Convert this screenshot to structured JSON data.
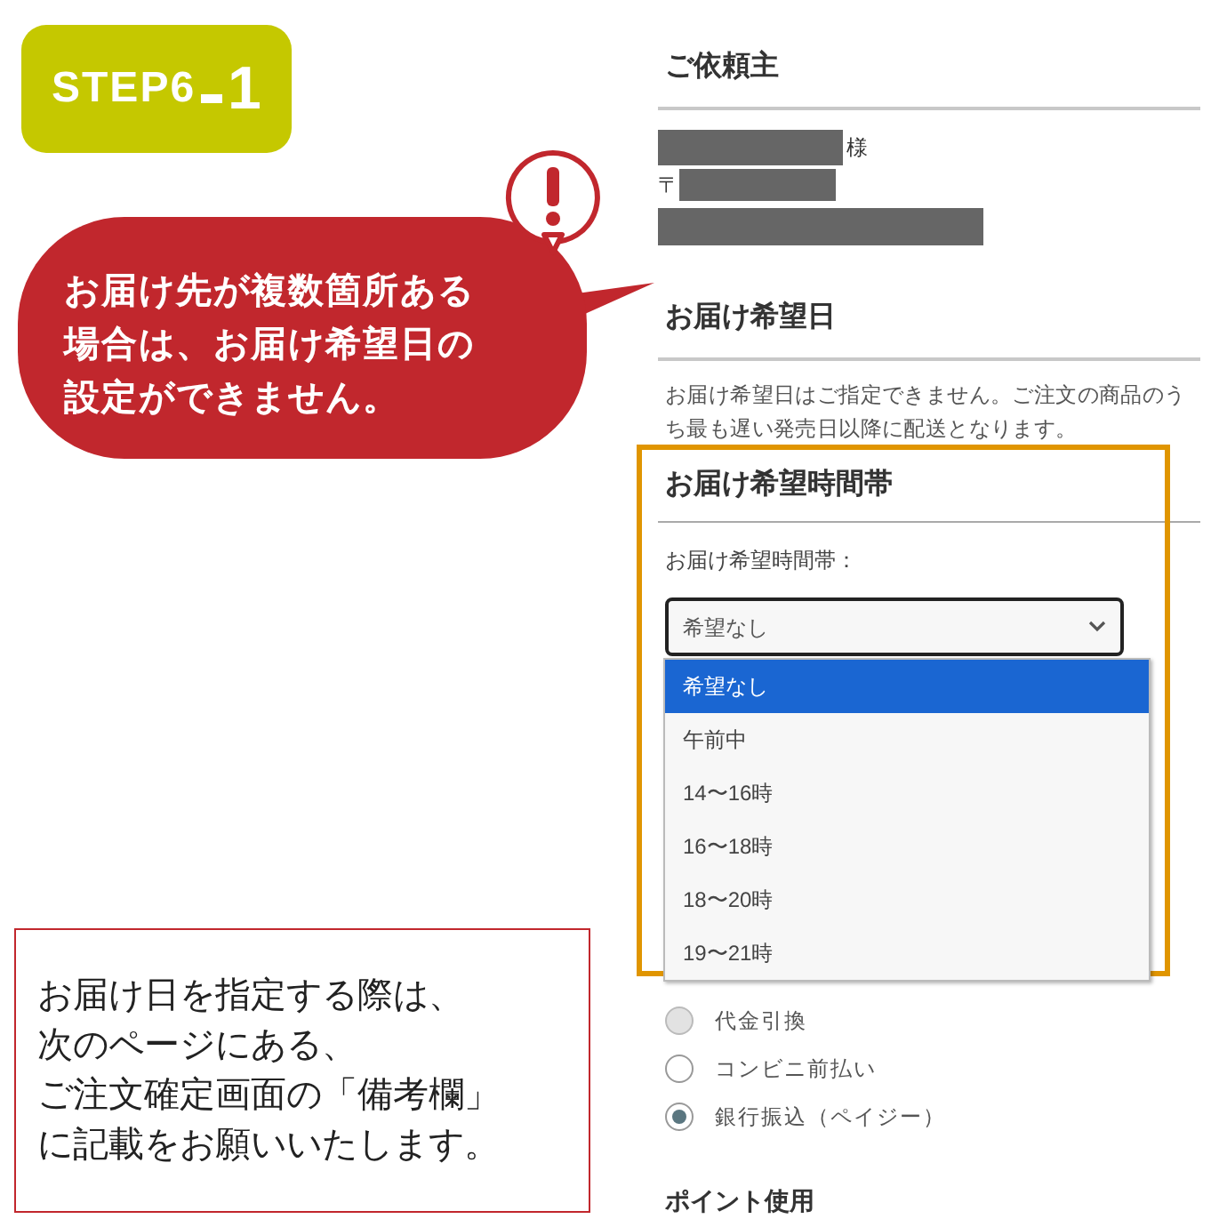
{
  "step_badge": {
    "label": "STEP6",
    "number": "1"
  },
  "warning_bubble": {
    "lines": [
      "お届け先が複数箇所ある",
      "場合は、お届け希望日の",
      "設定ができません。"
    ]
  },
  "note": {
    "lines": [
      "お届け日を指定する際は、",
      "次のページにある、",
      "ご注文確定画面の「備考欄」",
      "に記載をお願いいたします。"
    ]
  },
  "requester": {
    "title": "ご依頼主",
    "honorific": "様",
    "postal_mark": "〒"
  },
  "delivery_date": {
    "title": "お届け希望日",
    "message": "お届け希望日はご指定できません。ご注文の商品のうち最も遅い発売日以降に配送となります。"
  },
  "time_slot": {
    "title": "お届け希望時間帯",
    "label": "お届け希望時間帯：",
    "value": "希望なし",
    "expanded": true,
    "options": [
      {
        "label": "希望なし",
        "selected": true
      },
      {
        "label": "午前中",
        "selected": false
      },
      {
        "label": "14〜16時",
        "selected": false
      },
      {
        "label": "16〜18時",
        "selected": false
      },
      {
        "label": "18〜20時",
        "selected": false
      },
      {
        "label": "19〜21時",
        "selected": false
      }
    ]
  },
  "payment": {
    "options": [
      {
        "label": "代金引換",
        "selected": false,
        "disabled": true
      },
      {
        "label": "コンビニ前払い",
        "selected": false,
        "disabled": false
      },
      {
        "label": "銀行振込（ペイジー）",
        "selected": true,
        "disabled": false
      }
    ]
  },
  "points": {
    "title": "ポイント使用"
  }
}
